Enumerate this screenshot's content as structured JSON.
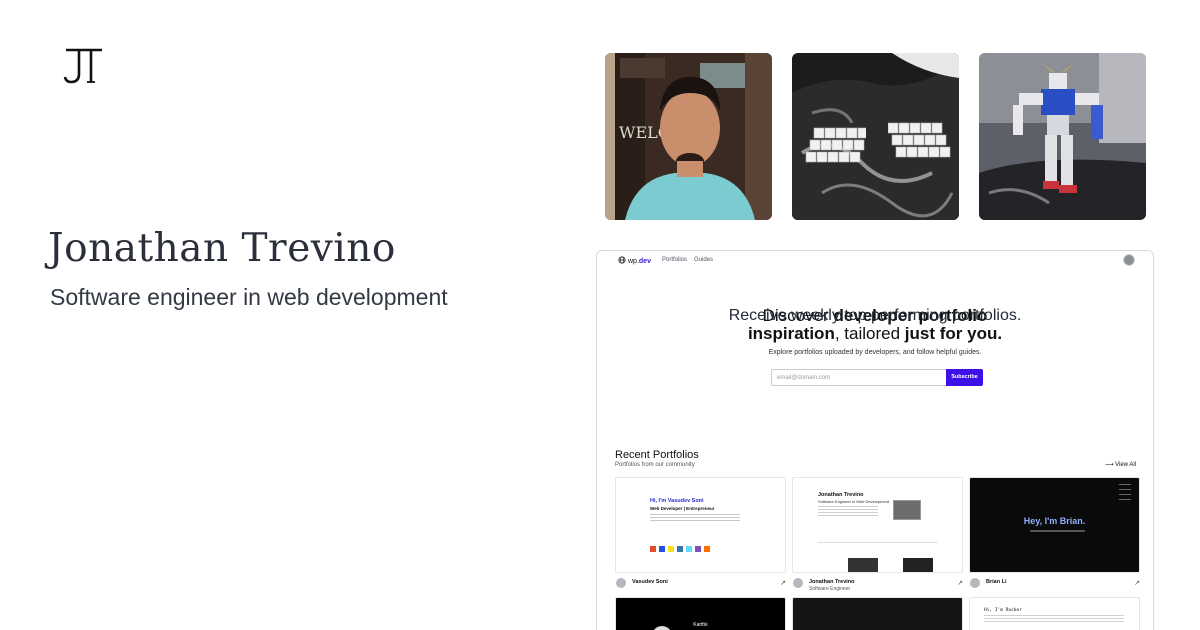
{
  "profile": {
    "monogram": "JT",
    "name": "Jonathan Trevino",
    "tagline": "Software engineer in web development"
  },
  "photos": [
    {
      "name": "portrait-photo",
      "welcome_text": "WELC"
    },
    {
      "name": "keyboard-keycaps-photo"
    },
    {
      "name": "gundam-figure-photo"
    }
  ],
  "screenshot": {
    "nav": {
      "brand_prefix": "wp.",
      "brand_suffix": "dev",
      "links": [
        "Portfolios",
        "Guides"
      ]
    },
    "hero": {
      "line1_plain": "Discover ",
      "line1_bold": "developer portfolio",
      "line2_bold_a": "inspiration",
      "line2_plain": ", tailored ",
      "line2_bold_b": "just for you.",
      "subtitle": "Explore portfolios uploaded by developers, and follow helpful guides.",
      "email_placeholder": "email@domain.com",
      "subscribe_label": "Subscribe",
      "note": "Receive weekly top performing portfolios."
    },
    "recent": {
      "title": "Recent Portfolios",
      "subtitle": "Portfolios from our community",
      "view_all": "View All"
    },
    "cards": [
      {
        "name": "Vasudev Soni",
        "role": "",
        "headline": "Hi, I'm Vasudev Soni",
        "sub": "Web Developer | Entrepreneur"
      },
      {
        "name": "Jonathan Trevino",
        "role": "Software Engineer",
        "headline": "Jonathan Trevino",
        "sub": "Software Engineer in Web Development"
      },
      {
        "name": "Brian Li",
        "role": "",
        "headline": "Hey, I'm Brian.",
        "sub": ""
      }
    ],
    "row2": [
      {
        "headline": "Karthk"
      },
      {
        "headline": ""
      },
      {
        "headline": "Hi, I'm Rocker"
      }
    ]
  },
  "colors": {
    "accent": "#3f0fe8",
    "brand_dev": "#3a1bd4",
    "text_dark": "#2b2f3a"
  }
}
